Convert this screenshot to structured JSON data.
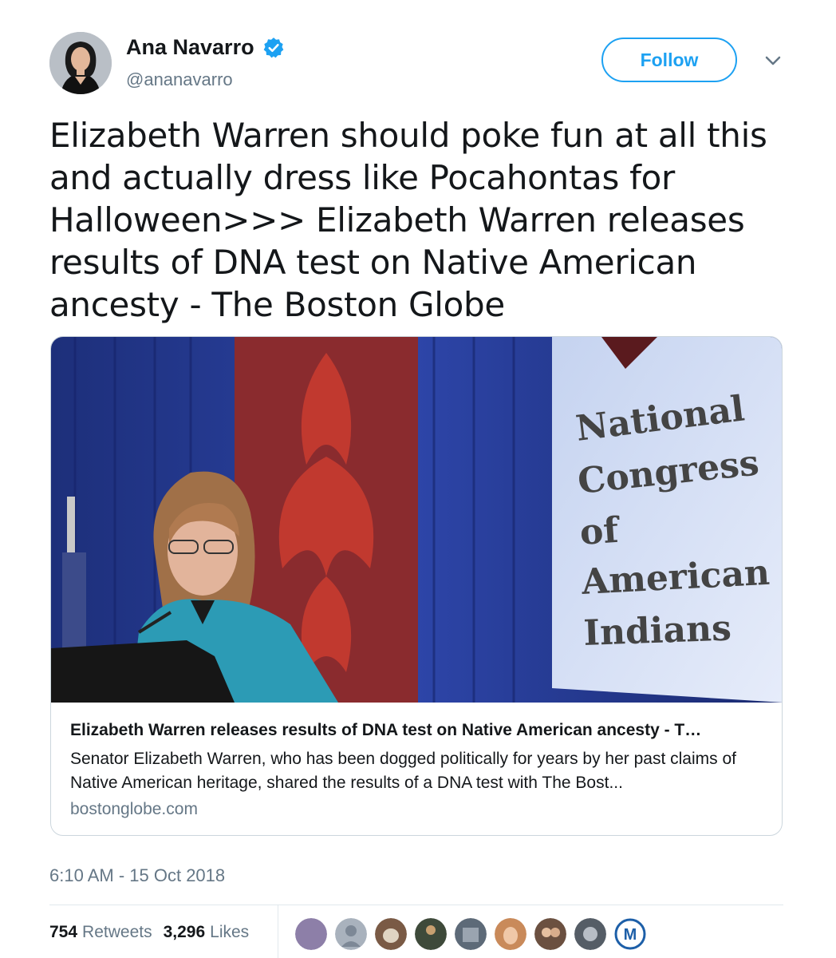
{
  "author": {
    "display_name": "Ana Navarro",
    "handle": "@ananavarro",
    "verified": true,
    "avatar_icon": "profile-photo"
  },
  "follow_button": {
    "label": "Follow"
  },
  "menu_icon": "chevron-down-icon",
  "tweet": {
    "text": "Elizabeth Warren should poke fun at all this and actually dress like Pocahontas for Halloween>>> Elizabeth Warren releases results of DNA test on Native American ancesty - The Boston Globe",
    "timestamp": "6:10 AM - 15 Oct 2018"
  },
  "link_card": {
    "image_banner_lines": [
      "National",
      "Congress",
      "of",
      "American",
      "Indians"
    ],
    "title": "Elizabeth Warren releases results of DNA test on Native American ancesty - T…",
    "description": "Senator Elizabeth Warren, who has been dogged politically for years by her past claims of Native American heritage, shared the results of a DNA test with The Bost...",
    "domain": "bostonglobe.com"
  },
  "stats": {
    "retweets_count": "754",
    "retweets_label": "Retweets",
    "likes_count": "3,296",
    "likes_label": "Likes"
  },
  "liker_avatar_colors": [
    "#8d7fa8",
    "#a9b2bd",
    "#7a5a45",
    "#3e4a3a",
    "#5d6a78",
    "#c98a5a",
    "#6b5040",
    "#555d66",
    "#ffffff"
  ],
  "liker_last_initial": "M",
  "colors": {
    "accent": "#1da1f2",
    "muted": "#657786",
    "text": "#14171a",
    "border": "#ccd6dd"
  }
}
